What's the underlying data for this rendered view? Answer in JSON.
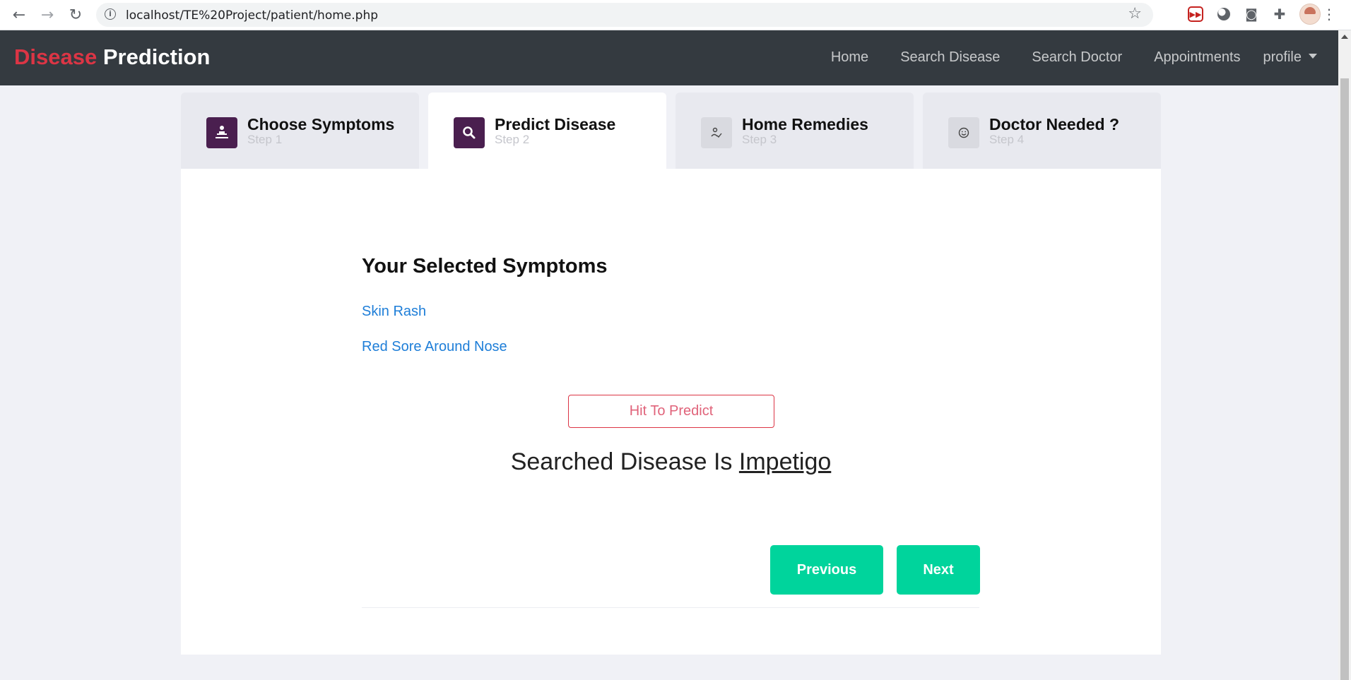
{
  "browser": {
    "url": "localhost/TE%20Project/patient/home.php",
    "back_icon": "back-arrow-icon",
    "forward_icon": "forward-arrow-icon",
    "reload_icon": "reload-icon"
  },
  "navbar": {
    "brand_part1": "Disease",
    "brand_part2": "Prediction",
    "links": [
      "Home",
      "Search Disease",
      "Search Doctor",
      "Appointments"
    ],
    "profile": "profile"
  },
  "wizard": {
    "tabs": [
      {
        "title": "Choose Symptoms",
        "step": "Step 1",
        "icon": "patient-icon"
      },
      {
        "title": "Predict Disease",
        "step": "Step 2",
        "icon": "search-icon"
      },
      {
        "title": "Home Remedies",
        "step": "Step 3",
        "icon": "signature-icon"
      },
      {
        "title": "Doctor Needed ?",
        "step": "Step 4",
        "icon": "smile-icon"
      }
    ],
    "active_step": 2
  },
  "content": {
    "symptoms_title": "Your Selected Symptoms",
    "symptoms": [
      "Skin Rash",
      "Red Sore Around Nose"
    ],
    "predict_button": "Hit To Predict",
    "result_prefix": "Searched Disease Is",
    "result_disease": "Impetigo",
    "previous_button": "Previous",
    "next_button": "Next"
  },
  "colors": {
    "navbar_bg": "#343a40",
    "brand_accent": "#dc3545",
    "step_icon_bg": "#4a1f4f",
    "button_green": "#00d49c",
    "link_blue": "#1e7ed8"
  }
}
